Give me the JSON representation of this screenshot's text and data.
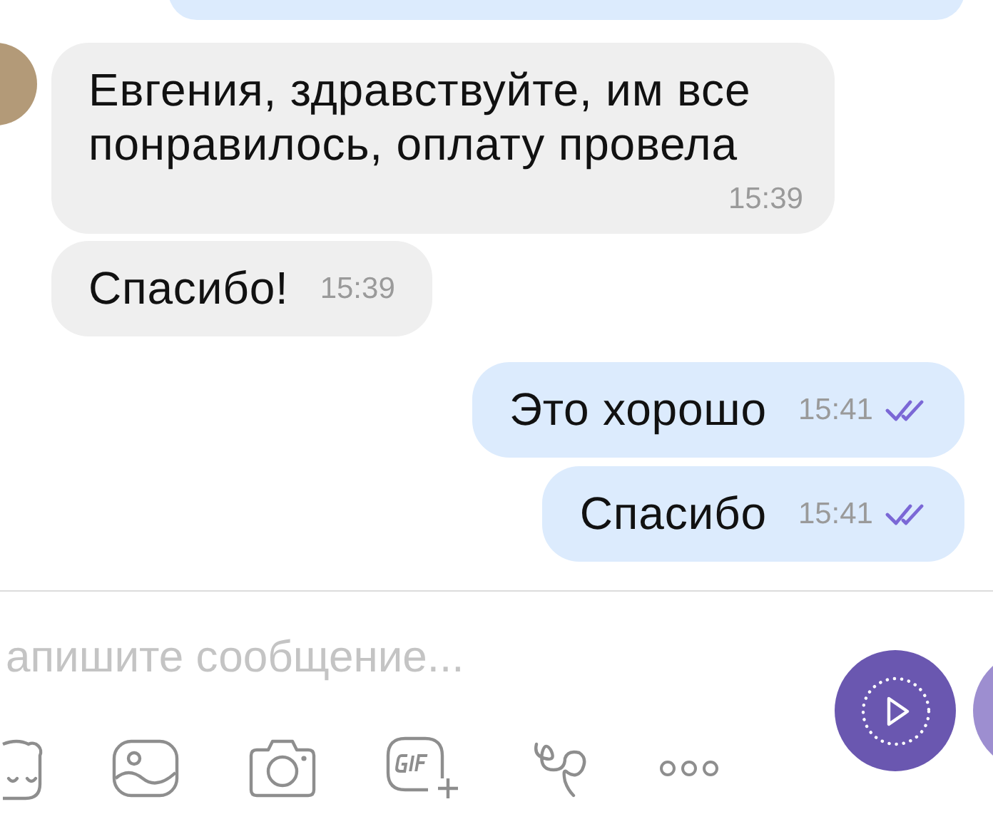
{
  "messages": [
    {
      "outgoing": true,
      "kind": "cropped"
    },
    {
      "outgoing": false,
      "kind": "text",
      "avatar": true,
      "text": "Евгения, здравствуйте, им все понравилось, оплату провела",
      "time": "15:39"
    },
    {
      "outgoing": false,
      "kind": "text",
      "avatar": false,
      "text": "Спасибо!",
      "time": "15:39"
    },
    {
      "outgoing": true,
      "kind": "text",
      "text": "Это хорошо",
      "time": "15:41",
      "read": true
    },
    {
      "outgoing": true,
      "kind": "text",
      "text": "Спасибо",
      "time": "15:41",
      "read": true
    }
  ],
  "composer": {
    "placeholder": "апишите сообщение..."
  }
}
